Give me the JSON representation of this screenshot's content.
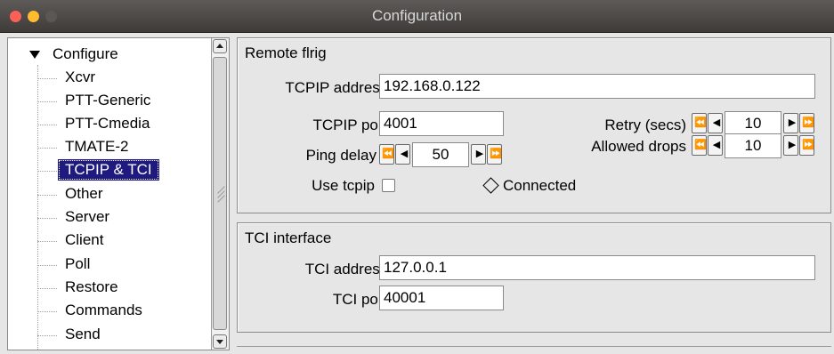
{
  "window": {
    "title": "Configuration"
  },
  "tree": {
    "root": "Configure",
    "items": [
      {
        "label": "Xcvr"
      },
      {
        "label": "PTT-Generic"
      },
      {
        "label": "PTT-Cmedia"
      },
      {
        "label": "TMATE-2"
      },
      {
        "label": "TCPIP & TCI",
        "selected": true
      },
      {
        "label": "Other"
      },
      {
        "label": "Server"
      },
      {
        "label": "Client"
      },
      {
        "label": "Poll"
      },
      {
        "label": "Restore"
      },
      {
        "label": "Commands"
      },
      {
        "label": "Send"
      }
    ]
  },
  "remote_flrig": {
    "heading": "Remote flrig",
    "tcpip_address_label": "TCPIP address:",
    "tcpip_address_value": "192.168.0.122",
    "tcpip_port_label": "TCPIP port:",
    "tcpip_port_value": "4001",
    "ping_delay_label": "Ping delay",
    "ping_delay_value": "50",
    "use_tcpip_label": "Use tcpip",
    "use_tcpip_checked": false,
    "connected_label": "Connected",
    "retry_label": "Retry (secs)",
    "retry_value": "10",
    "allowed_drops_label": "Allowed drops",
    "allowed_drops_value": "10"
  },
  "tci_interface": {
    "heading": "TCI interface",
    "tci_address_label": "TCI address:",
    "tci_address_value": "127.0.0.1",
    "tci_port_label": "TCI port:",
    "tci_port_value": "40001"
  },
  "colors": {
    "selection": "#1e1a80",
    "close": "#fe5f57",
    "minimize": "#febc2e"
  },
  "icons": {
    "fast_back": "⏪",
    "back": "◀",
    "forward": "▶",
    "fast_forward": "⏩"
  }
}
